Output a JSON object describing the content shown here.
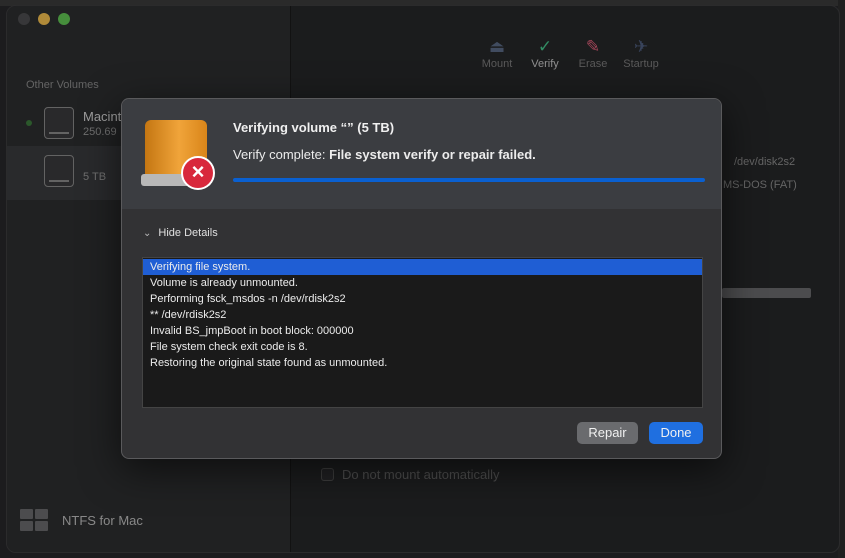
{
  "sidebar": {
    "section_title": "Other Volumes",
    "volumes": [
      {
        "name": "Macint",
        "size": "250.69"
      },
      {
        "name": "",
        "size": "5 TB"
      }
    ],
    "brand": "NTFS for Mac"
  },
  "toolbar": {
    "items": [
      {
        "label": "Mount",
        "icon": "mount-icon"
      },
      {
        "label": "Verify",
        "icon": "checkmark-icon"
      },
      {
        "label": "Erase",
        "icon": "eraser-icon"
      },
      {
        "label": "Startup",
        "icon": "startup-icon"
      }
    ]
  },
  "main": {
    "device": "/dev/disk2s2",
    "format": "MS-DOS (FAT)",
    "checkbox_label": "Do not mount automatically"
  },
  "dialog": {
    "title": "Verifying volume “” (5 TB)",
    "status_prefix": "Verify complete:",
    "status_bold": "File system verify or repair failed.",
    "progress": 1.0,
    "details_label": "Hide Details",
    "log": [
      "Verifying file system.",
      "Volume is already unmounted.",
      "Performing fsck_msdos -n /dev/rdisk2s2",
      "** /dev/rdisk2s2",
      "Invalid BS_jmpBoot in boot block: 000000",
      "File system check exit code is 8.",
      "Restoring the original state found as unmounted."
    ],
    "repair_label": "Repair",
    "done_label": "Done"
  },
  "colors": {
    "accent": "#1f6fe0",
    "error": "#d8283c",
    "selection": "#1f5ed4"
  }
}
